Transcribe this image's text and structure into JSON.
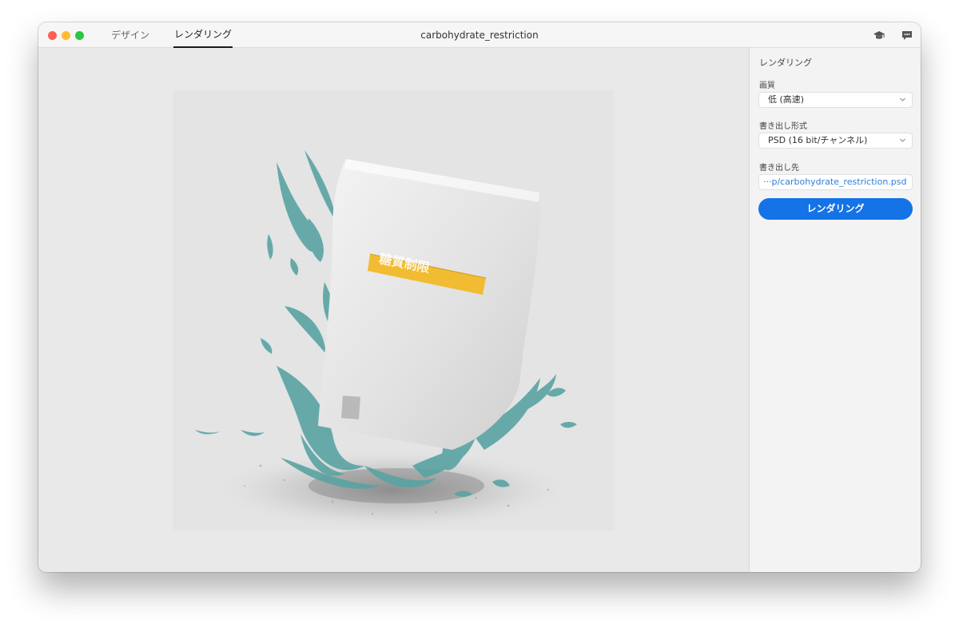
{
  "window": {
    "tabs": [
      {
        "label": "デザイン",
        "active": false
      },
      {
        "label": "レンダリング",
        "active": true
      }
    ],
    "document_title": "carbohydrate_restriction"
  },
  "toolbar_icons": [
    "learn-icon",
    "feedback-icon"
  ],
  "preview": {
    "description_icon": "image-preview",
    "product_label_text": "糖質制限"
  },
  "panel": {
    "title": "レンダリング",
    "quality": {
      "label": "画質",
      "value": "低 (高速)"
    },
    "export_format": {
      "label": "書き出し形式",
      "value": "PSD (16 bit/チャンネル)"
    },
    "export_destination": {
      "label": "書き出し先",
      "value": "···p/carbohydrate_restriction.psd"
    },
    "render_button_label": "レンダリング"
  },
  "colors": {
    "accent": "#1473e6",
    "path_link": "#2f7fd6",
    "splash": "#5aa3a3",
    "label_yellow": "#f2b928"
  }
}
